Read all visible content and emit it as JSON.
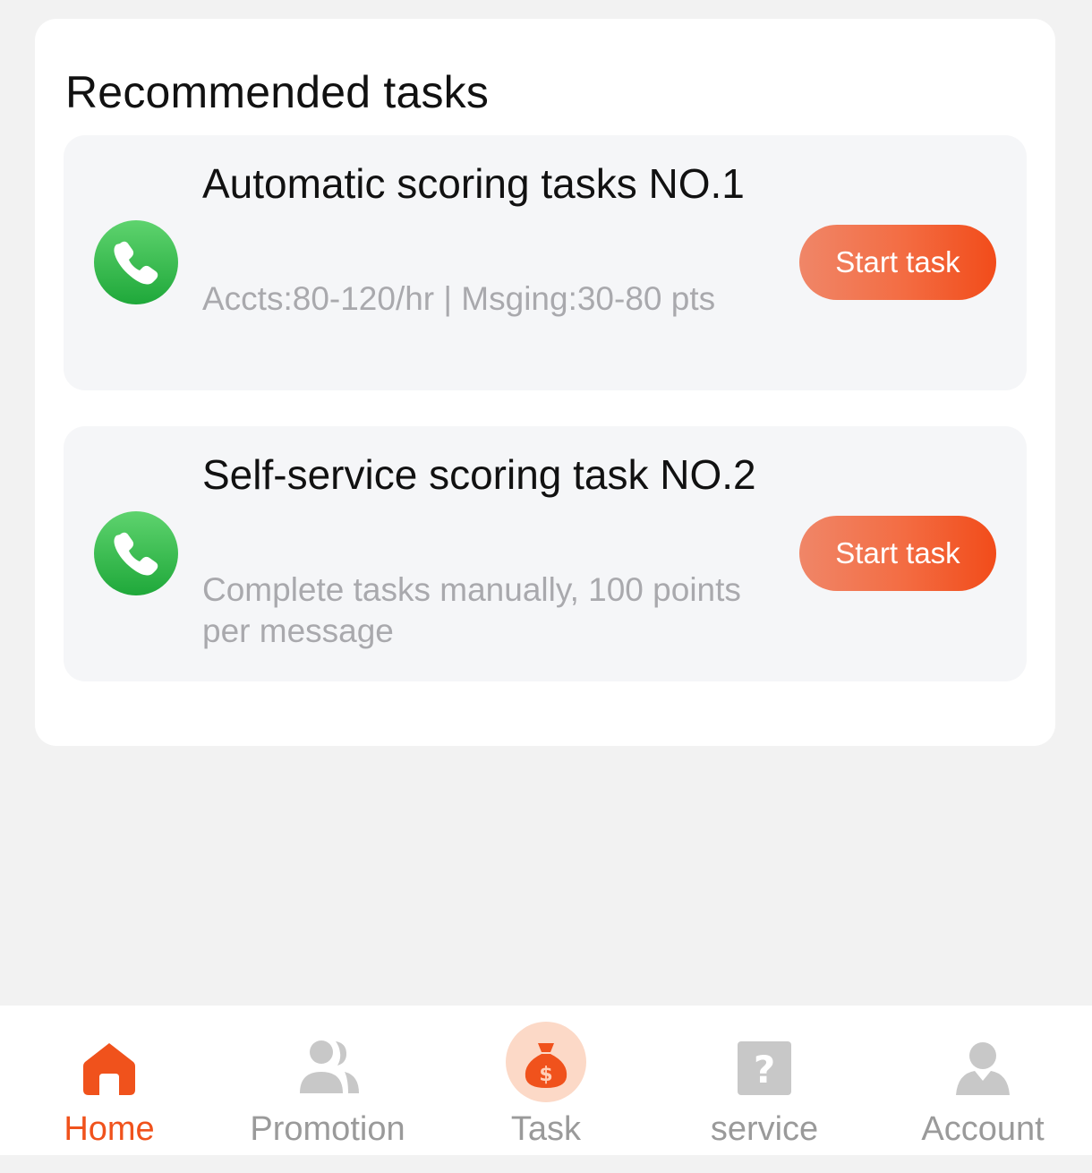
{
  "section": {
    "title": "Recommended tasks"
  },
  "tasks": [
    {
      "title": "Automatic scoring tasks NO.1",
      "description": "Accts:80-120/hr | Msging:30-80 pts",
      "button_label": "Start task",
      "icon": "whatsapp-phone-icon"
    },
    {
      "title": "Self-service scoring task NO.2",
      "description": "Complete tasks manually, 100 points per message",
      "button_label": "Start task",
      "icon": "whatsapp-phone-icon"
    }
  ],
  "tabbar": {
    "items": [
      {
        "label": "Home",
        "icon": "home-icon",
        "active": true
      },
      {
        "label": "Promotion",
        "icon": "people-icon",
        "active": false
      },
      {
        "label": "Task",
        "icon": "money-bag-icon",
        "active": false
      },
      {
        "label": "service",
        "icon": "help-icon",
        "active": false
      },
      {
        "label": "Account",
        "icon": "user-icon",
        "active": false
      }
    ]
  },
  "colors": {
    "accent": "#f0521c",
    "button_gradient_start": "#f08668",
    "button_gradient_end": "#f24c1a",
    "icon_green": "#2fb947",
    "inactive": "#9a9a9a"
  }
}
